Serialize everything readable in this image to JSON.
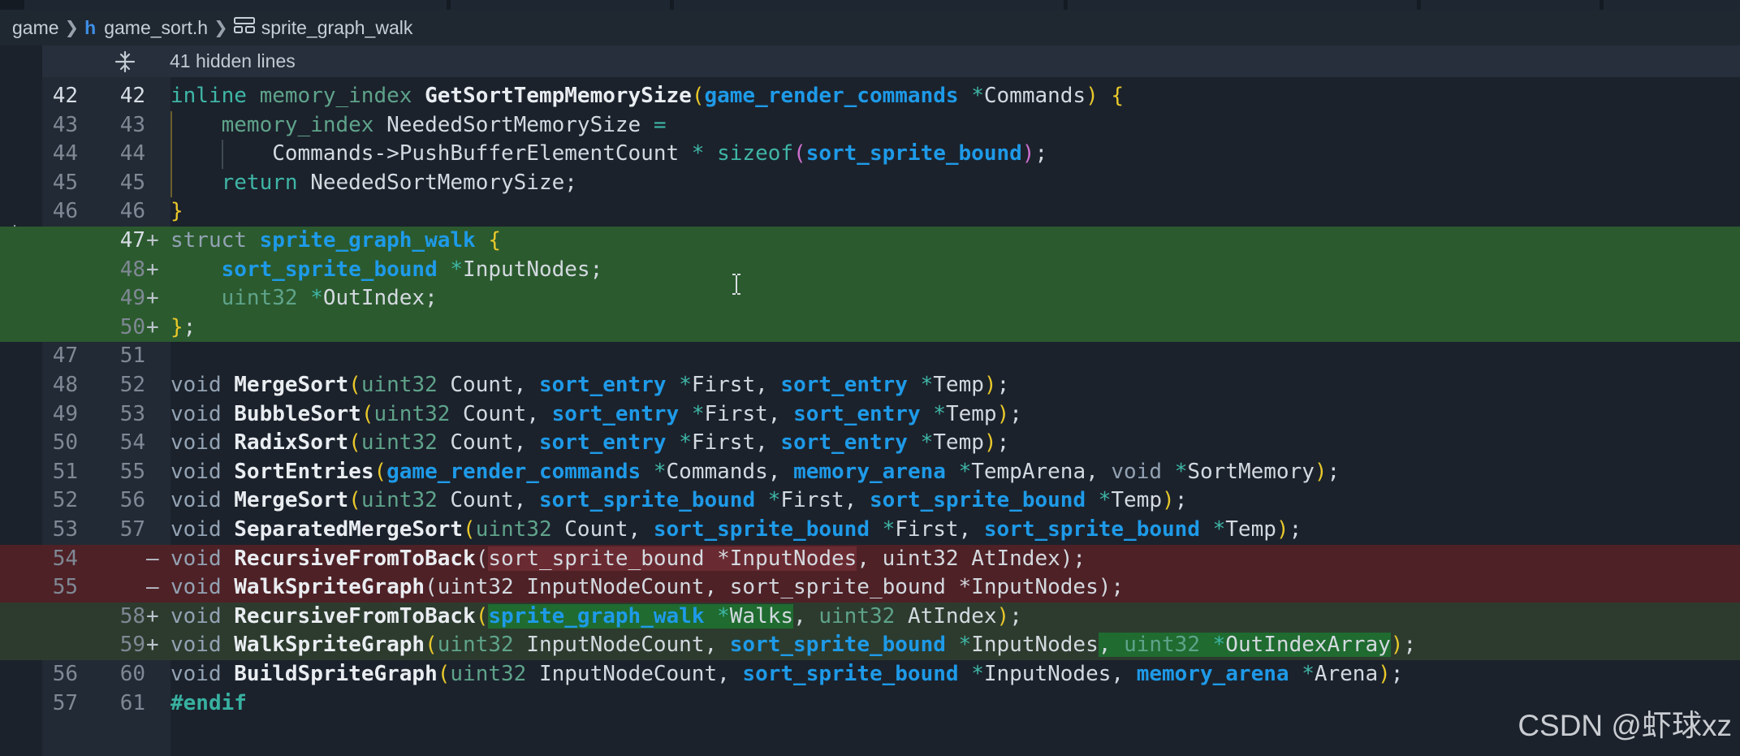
{
  "breadcrumb": {
    "folder": "game",
    "file_icon": "h",
    "file": "game_sort.h",
    "symbol": "sprite_graph_walk"
  },
  "hidden_lines_label": "41 hidden lines",
  "watermark": "CSDN @虾球xz",
  "colors": {
    "added_line": "#2b5a2e",
    "deleted_line": "#4e2126",
    "keyword_type": "#1e9ae8",
    "function_name": "#e9edf1"
  },
  "lines": [
    {
      "old": "42",
      "new": "42",
      "sign": "",
      "bg": "",
      "active": true,
      "tokens": [
        [
          "kwb",
          "inline"
        ],
        [
          "tx",
          " "
        ],
        [
          "tyd",
          "memory_index"
        ],
        [
          "tx",
          " "
        ],
        [
          "fn",
          "GetSortTempMemorySize"
        ],
        [
          "p1",
          "("
        ],
        [
          "ty",
          "game_render_commands"
        ],
        [
          "tx",
          " "
        ],
        [
          "op",
          "*"
        ],
        [
          "tx",
          "Commands"
        ],
        [
          "p1",
          ")"
        ],
        [
          "tx",
          " "
        ],
        [
          "p1",
          "{"
        ]
      ]
    },
    {
      "old": "43",
      "new": "43",
      "sign": "",
      "bg": "",
      "tokens": [
        [
          "tx",
          "    "
        ],
        [
          "tyd",
          "memory_index"
        ],
        [
          "tx",
          " NeededSortMemorySize "
        ],
        [
          "op",
          "="
        ]
      ]
    },
    {
      "old": "44",
      "new": "44",
      "sign": "",
      "bg": "",
      "tokens": [
        [
          "tx",
          "        Commands->PushBufferElementCount "
        ],
        [
          "op",
          "*"
        ],
        [
          "tx",
          " "
        ],
        [
          "kwb",
          "sizeof"
        ],
        [
          "p2",
          "("
        ],
        [
          "ty",
          "sort_sprite_bound"
        ],
        [
          "p2",
          ")"
        ],
        [
          "tx",
          ";"
        ]
      ]
    },
    {
      "old": "45",
      "new": "45",
      "sign": "",
      "bg": "",
      "tokens": [
        [
          "tx",
          "    "
        ],
        [
          "kwb",
          "return"
        ],
        [
          "tx",
          " NeededSortMemorySize;"
        ]
      ]
    },
    {
      "old": "46",
      "new": "46",
      "sign": "",
      "bg": "",
      "tokens": [
        [
          "p1",
          "}"
        ]
      ]
    },
    {
      "old": "",
      "new": "47",
      "sign": "+",
      "bg": "add",
      "active": true,
      "tokens": [
        [
          "kw",
          "struct"
        ],
        [
          "tx",
          " "
        ],
        [
          "ty",
          "sprite_graph_walk"
        ],
        [
          "tx",
          " "
        ],
        [
          "p1",
          "{"
        ]
      ]
    },
    {
      "old": "",
      "new": "48",
      "sign": "+",
      "bg": "add",
      "tokens": [
        [
          "tx",
          "    "
        ],
        [
          "ty",
          "sort_sprite_bound"
        ],
        [
          "tx",
          " "
        ],
        [
          "op",
          "*"
        ],
        [
          "tx",
          "InputNodes;"
        ]
      ]
    },
    {
      "old": "",
      "new": "49",
      "sign": "+",
      "bg": "add",
      "tokens": [
        [
          "tx",
          "    "
        ],
        [
          "tyd",
          "uint32"
        ],
        [
          "tx",
          " "
        ],
        [
          "op",
          "*"
        ],
        [
          "tx",
          "OutIndex;"
        ]
      ]
    },
    {
      "old": "",
      "new": "50",
      "sign": "+",
      "bg": "add",
      "tokens": [
        [
          "p1",
          "}"
        ],
        [
          "tx",
          ";"
        ]
      ]
    },
    {
      "old": "47",
      "new": "51",
      "sign": "",
      "bg": "",
      "tokens": []
    },
    {
      "old": "48",
      "new": "52",
      "sign": "",
      "bg": "",
      "tokens": [
        [
          "kw",
          "void"
        ],
        [
          "tx",
          " "
        ],
        [
          "fn",
          "MergeSort"
        ],
        [
          "p1",
          "("
        ],
        [
          "tyd",
          "uint32"
        ],
        [
          "tx",
          " Count, "
        ],
        [
          "ty",
          "sort_entry"
        ],
        [
          "tx",
          " "
        ],
        [
          "op",
          "*"
        ],
        [
          "tx",
          "First, "
        ],
        [
          "ty",
          "sort_entry"
        ],
        [
          "tx",
          " "
        ],
        [
          "op",
          "*"
        ],
        [
          "tx",
          "Temp"
        ],
        [
          "p1",
          ")"
        ],
        [
          "tx",
          ";"
        ]
      ]
    },
    {
      "old": "49",
      "new": "53",
      "sign": "",
      "bg": "",
      "tokens": [
        [
          "kw",
          "void"
        ],
        [
          "tx",
          " "
        ],
        [
          "fn",
          "BubbleSort"
        ],
        [
          "p1",
          "("
        ],
        [
          "tyd",
          "uint32"
        ],
        [
          "tx",
          " Count, "
        ],
        [
          "ty",
          "sort_entry"
        ],
        [
          "tx",
          " "
        ],
        [
          "op",
          "*"
        ],
        [
          "tx",
          "First, "
        ],
        [
          "ty",
          "sort_entry"
        ],
        [
          "tx",
          " "
        ],
        [
          "op",
          "*"
        ],
        [
          "tx",
          "Temp"
        ],
        [
          "p1",
          ")"
        ],
        [
          "tx",
          ";"
        ]
      ]
    },
    {
      "old": "50",
      "new": "54",
      "sign": "",
      "bg": "",
      "tokens": [
        [
          "kw",
          "void"
        ],
        [
          "tx",
          " "
        ],
        [
          "fn",
          "RadixSort"
        ],
        [
          "p1",
          "("
        ],
        [
          "tyd",
          "uint32"
        ],
        [
          "tx",
          " Count, "
        ],
        [
          "ty",
          "sort_entry"
        ],
        [
          "tx",
          " "
        ],
        [
          "op",
          "*"
        ],
        [
          "tx",
          "First, "
        ],
        [
          "ty",
          "sort_entry"
        ],
        [
          "tx",
          " "
        ],
        [
          "op",
          "*"
        ],
        [
          "tx",
          "Temp"
        ],
        [
          "p1",
          ")"
        ],
        [
          "tx",
          ";"
        ]
      ]
    },
    {
      "old": "51",
      "new": "55",
      "sign": "",
      "bg": "",
      "tokens": [
        [
          "kw",
          "void"
        ],
        [
          "tx",
          " "
        ],
        [
          "fn",
          "SortEntries"
        ],
        [
          "p1",
          "("
        ],
        [
          "ty",
          "game_render_commands"
        ],
        [
          "tx",
          " "
        ],
        [
          "op",
          "*"
        ],
        [
          "tx",
          "Commands, "
        ],
        [
          "ty",
          "memory_arena"
        ],
        [
          "tx",
          " "
        ],
        [
          "op",
          "*"
        ],
        [
          "tx",
          "TempArena, "
        ],
        [
          "kw",
          "void"
        ],
        [
          "tx",
          " "
        ],
        [
          "op",
          "*"
        ],
        [
          "tx",
          "SortMemory"
        ],
        [
          "p1",
          ")"
        ],
        [
          "tx",
          ";"
        ]
      ]
    },
    {
      "old": "52",
      "new": "56",
      "sign": "",
      "bg": "",
      "tokens": [
        [
          "kw",
          "void"
        ],
        [
          "tx",
          " "
        ],
        [
          "fn",
          "MergeSort"
        ],
        [
          "p1",
          "("
        ],
        [
          "tyd",
          "uint32"
        ],
        [
          "tx",
          " Count, "
        ],
        [
          "ty",
          "sort_sprite_bound"
        ],
        [
          "tx",
          " "
        ],
        [
          "op",
          "*"
        ],
        [
          "tx",
          "First, "
        ],
        [
          "ty",
          "sort_sprite_bound"
        ],
        [
          "tx",
          " "
        ],
        [
          "op",
          "*"
        ],
        [
          "tx",
          "Temp"
        ],
        [
          "p1",
          ")"
        ],
        [
          "tx",
          ";"
        ]
      ]
    },
    {
      "old": "53",
      "new": "57",
      "sign": "",
      "bg": "",
      "tokens": [
        [
          "kw",
          "void"
        ],
        [
          "tx",
          " "
        ],
        [
          "fn",
          "SeparatedMergeSort"
        ],
        [
          "p1",
          "("
        ],
        [
          "tyd",
          "uint32"
        ],
        [
          "tx",
          " Count, "
        ],
        [
          "ty",
          "sort_sprite_bound"
        ],
        [
          "tx",
          " "
        ],
        [
          "op",
          "*"
        ],
        [
          "tx",
          "First, "
        ],
        [
          "ty",
          "sort_sprite_bound"
        ],
        [
          "tx",
          " "
        ],
        [
          "op",
          "*"
        ],
        [
          "tx",
          "Temp"
        ],
        [
          "p1",
          ")"
        ],
        [
          "tx",
          ";"
        ]
      ]
    },
    {
      "old": "54",
      "new": "",
      "sign": "—",
      "bg": "del",
      "tokens": [
        [
          "kw",
          "void"
        ],
        [
          "tx",
          " "
        ],
        [
          "fn",
          "RecursiveFromToBack"
        ],
        [
          "tx",
          "("
        ],
        [
          "tx hl-red",
          "sort_sprite_bound *InputNodes"
        ],
        [
          "tx",
          ", uint32 AtIndex);"
        ]
      ]
    },
    {
      "old": "55",
      "new": "",
      "sign": "—",
      "bg": "del",
      "tokens": [
        [
          "kw",
          "void"
        ],
        [
          "tx",
          " "
        ],
        [
          "fn",
          "WalkSpriteGraph"
        ],
        [
          "tx",
          "(uint32 InputNodeCount, sort_sprite_bound *InputNodes);"
        ]
      ]
    },
    {
      "old": "",
      "new": "58",
      "sign": "+",
      "bg": "mod",
      "tokens": [
        [
          "kw",
          "void"
        ],
        [
          "tx",
          " "
        ],
        [
          "fn",
          "RecursiveFromToBack"
        ],
        [
          "p1",
          "("
        ],
        [
          "ty hl-green",
          "sprite_graph_walk"
        ],
        [
          "tx hl-green",
          " "
        ],
        [
          "op hl-green",
          "*"
        ],
        [
          "tx hl-green",
          "Walks"
        ],
        [
          "tx",
          ", "
        ],
        [
          "tyd",
          "uint32"
        ],
        [
          "tx",
          " AtIndex"
        ],
        [
          "p1",
          ")"
        ],
        [
          "tx",
          ";"
        ]
      ]
    },
    {
      "old": "",
      "new": "59",
      "sign": "+",
      "bg": "mod",
      "tokens": [
        [
          "kw",
          "void"
        ],
        [
          "tx",
          " "
        ],
        [
          "fn",
          "WalkSpriteGraph"
        ],
        [
          "p1",
          "("
        ],
        [
          "tyd",
          "uint32"
        ],
        [
          "tx",
          " InputNodeCount, "
        ],
        [
          "ty",
          "sort_sprite_bound"
        ],
        [
          "tx",
          " "
        ],
        [
          "op",
          "*"
        ],
        [
          "tx",
          "InputNodes"
        ],
        [
          "tx hl-green",
          ", "
        ],
        [
          "tyd hl-green",
          "uint32"
        ],
        [
          "tx hl-green",
          " "
        ],
        [
          "op hl-green",
          "*"
        ],
        [
          "tx hl-green",
          "OutIndexArray"
        ],
        [
          "p1",
          ")"
        ],
        [
          "tx",
          ";"
        ]
      ]
    },
    {
      "old": "56",
      "new": "60",
      "sign": "",
      "bg": "",
      "tokens": [
        [
          "kw",
          "void"
        ],
        [
          "tx",
          " "
        ],
        [
          "fn",
          "BuildSpriteGraph"
        ],
        [
          "p1",
          "("
        ],
        [
          "tyd",
          "uint32"
        ],
        [
          "tx",
          " InputNodeCount, "
        ],
        [
          "ty",
          "sort_sprite_bound"
        ],
        [
          "tx",
          " "
        ],
        [
          "op",
          "*"
        ],
        [
          "tx",
          "InputNodes, "
        ],
        [
          "ty",
          "memory_arena"
        ],
        [
          "tx",
          " "
        ],
        [
          "op",
          "*"
        ],
        [
          "tx",
          "Arena"
        ],
        [
          "p1",
          ")"
        ],
        [
          "tx",
          ";"
        ]
      ]
    },
    {
      "old": "57",
      "new": "61",
      "sign": "",
      "bg": "",
      "tokens": [
        [
          "pp",
          "#endif"
        ]
      ]
    }
  ]
}
